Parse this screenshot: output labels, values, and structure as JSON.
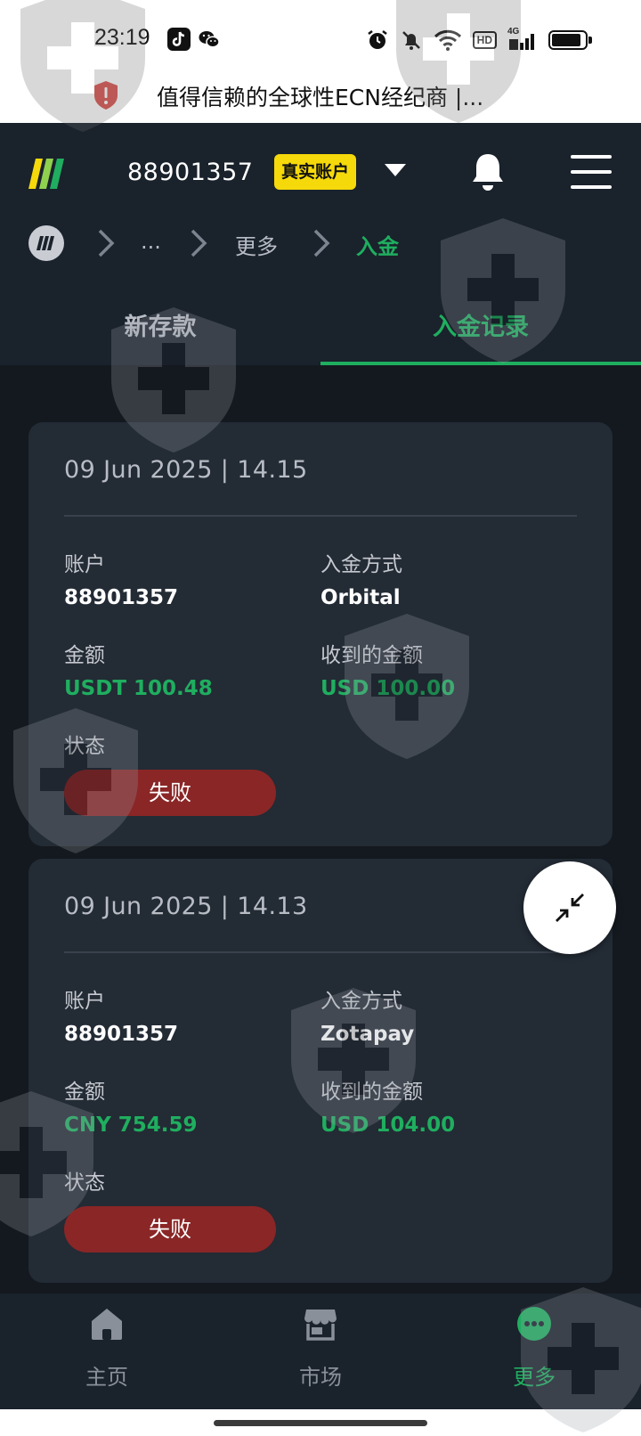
{
  "status_bar": {
    "time": "23:19",
    "icons": [
      "tiktok-icon",
      "wechat-icon",
      "alarm-icon",
      "mute-icon",
      "wifi-icon",
      "hd-icon",
      "signal-4g-icon",
      "battery-icon"
    ],
    "hd_label": "HD",
    "network_label": "4G",
    "battery_level": 0.8
  },
  "browser": {
    "page_title": "值得信赖的全球性ECN经纪商 |..."
  },
  "header": {
    "account_number": "88901357",
    "account_type_badge": "真实账户",
    "colors": {
      "badge": "#f5d90a",
      "accent": "#1fae5f"
    }
  },
  "breadcrumb": {
    "ellipsis": "...",
    "more": "更多",
    "current": "入金"
  },
  "tabs": [
    {
      "label": "新存款",
      "active": false
    },
    {
      "label": "入金记录",
      "active": true
    }
  ],
  "labels": {
    "account": "账户",
    "method": "入金方式",
    "amount": "金额",
    "received": "收到的金额",
    "status": "状态"
  },
  "deposits": [
    {
      "datetime": "09 Jun 2025 | 14.15",
      "account": "88901357",
      "method": "Orbital",
      "amount": "USDT 100.48",
      "received": "USD 100.00",
      "status": "失败"
    },
    {
      "datetime": "09 Jun 2025 | 14.13",
      "account": "88901357",
      "method": "Zotapay",
      "amount": "CNY 754.59",
      "received": "USD 104.00",
      "status": "失败"
    }
  ],
  "bottom_nav": [
    {
      "label": "主页",
      "icon": "home-icon",
      "active": false
    },
    {
      "label": "市场",
      "icon": "market-icon",
      "active": false
    },
    {
      "label": "更多",
      "icon": "more-icon",
      "active": true
    }
  ]
}
